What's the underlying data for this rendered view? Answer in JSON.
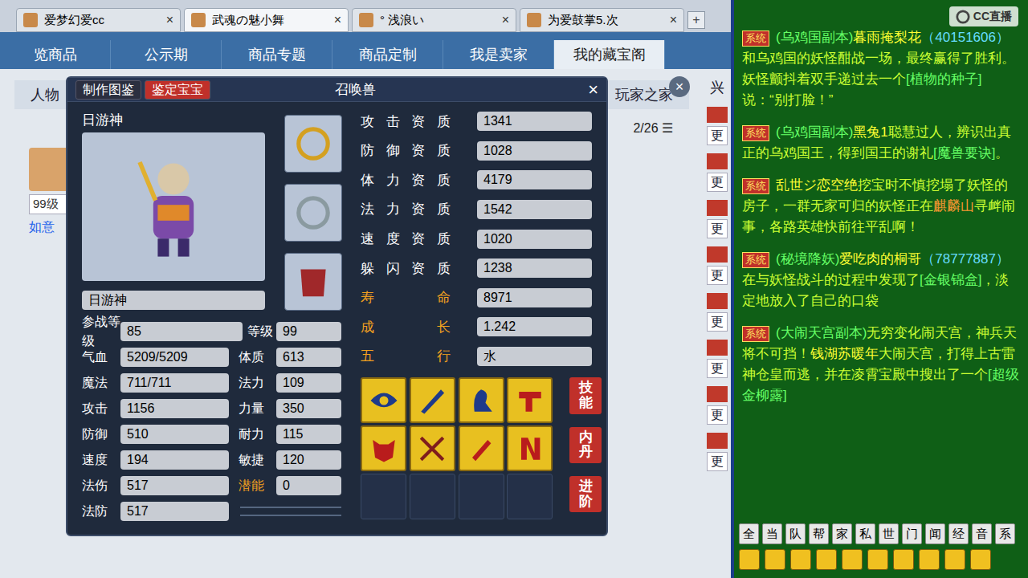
{
  "browser_tabs": [
    {
      "label": "爱梦幻爱cc",
      "selected": false,
      "close": "×"
    },
    {
      "label": "武魂の魅小舞",
      "selected": true,
      "close": "×"
    },
    {
      "label": "° 浅浪い",
      "selected": false,
      "close": "×"
    },
    {
      "label": "为爱鼓掌5.次",
      "selected": false,
      "close": "×"
    }
  ],
  "add_tab": "+",
  "nav": [
    {
      "label": "览商品",
      "selected": false
    },
    {
      "label": "公示期",
      "selected": false
    },
    {
      "label": "商品专题",
      "selected": false
    },
    {
      "label": "商品定制",
      "selected": false
    },
    {
      "label": "我是卖家",
      "selected": false
    },
    {
      "label": "我的藏宝阁",
      "selected": true
    }
  ],
  "page_close": "×",
  "background": {
    "tab_left": "人物",
    "tab_right": "玩家之家",
    "page_count": "2/26",
    "level": "99级",
    "link": "如意",
    "corner": "兴",
    "side_buttons": [
      "更",
      "更",
      "更",
      "更",
      "更",
      "更",
      "更",
      "更"
    ]
  },
  "dialog": {
    "buttons": [
      {
        "label": "制作图鉴",
        "selected": false
      },
      {
        "label": "鉴定宝宝",
        "selected": true
      }
    ],
    "title": "召唤兽",
    "close": "×",
    "pet_name": "日游神",
    "name_field": "日游神",
    "equipment_slots": 3,
    "battle_level": {
      "label": "参战等级",
      "value": "85"
    },
    "level": {
      "label": "等级",
      "value": "99"
    },
    "stats": [
      {
        "label": "气血",
        "value": "5209/5209",
        "label2": "体质",
        "value2": "613",
        "highlight2": false
      },
      {
        "label": "魔法",
        "value": "711/711",
        "label2": "法力",
        "value2": "109",
        "highlight2": false
      },
      {
        "label": "攻击",
        "value": "1156",
        "label2": "力量",
        "value2": "350",
        "highlight2": false
      },
      {
        "label": "防御",
        "value": "510",
        "label2": "耐力",
        "value2": "115",
        "highlight2": false
      },
      {
        "label": "速度",
        "value": "194",
        "label2": "敏捷",
        "value2": "120",
        "highlight2": false
      },
      {
        "label": "法伤",
        "value": "517",
        "label2": "潜能",
        "value2": "0",
        "highlight2": true
      },
      {
        "label": "法防",
        "value": "517",
        "label2": "",
        "value2": "",
        "highlight2": false
      }
    ],
    "aptitudes": [
      {
        "label": "攻击资质",
        "value": "1341",
        "highlight": false
      },
      {
        "label": "防御资质",
        "value": "1028",
        "highlight": false
      },
      {
        "label": "体力资质",
        "value": "4179",
        "highlight": false
      },
      {
        "label": "法力资质",
        "value": "1542",
        "highlight": false
      },
      {
        "label": "速度资质",
        "value": "1020",
        "highlight": false
      },
      {
        "label": "躲闪资质",
        "value": "1238",
        "highlight": false
      },
      {
        "label": "寿命",
        "value": "8971",
        "highlight": true
      },
      {
        "label": "成长",
        "value": "1.242",
        "highlight": true
      },
      {
        "label": "五行",
        "value": "水",
        "highlight": true
      }
    ],
    "skills": [
      {
        "filled": true
      },
      {
        "filled": true
      },
      {
        "filled": true
      },
      {
        "filled": true
      },
      {
        "filled": true
      },
      {
        "filled": true
      },
      {
        "filled": true
      },
      {
        "filled": true
      },
      {
        "filled": false
      },
      {
        "filled": false
      },
      {
        "filled": false
      },
      {
        "filled": false
      }
    ],
    "side_buttons": [
      "技能",
      "内丹",
      "进阶"
    ]
  },
  "chat": {
    "logo": "CC直播",
    "messages": [
      {
        "tag": "系统",
        "segments": [
          {
            "text": "(乌鸡国副本)",
            "color": "#66ff66"
          },
          {
            "text": "暮雨掩梨花",
            "color": "#ffff33"
          },
          {
            "text": "（40151606）",
            "color": "#66ddff"
          },
          {
            "text": "和乌鸡国的妖怪酣战一场，最终赢得了胜利。妖怪颤抖着双手递过去一个",
            "color": "#ccff33"
          },
          {
            "text": "[植物的种子]",
            "color": "#66ff66"
          },
          {
            "text": "说：“别打脸！”",
            "color": "#ccff33"
          }
        ]
      },
      {
        "tag": "系统",
        "segments": [
          {
            "text": "(乌鸡国副本)",
            "color": "#66ff66"
          },
          {
            "text": "黑兔1",
            "color": "#ffff33"
          },
          {
            "text": "聪慧过人，辨识出真正的乌鸡国王，得到国王的谢礼",
            "color": "#ccff33"
          },
          {
            "text": "[魔兽要诀]",
            "color": "#66ff66"
          },
          {
            "text": "。",
            "color": "#ccff33"
          }
        ]
      },
      {
        "tag": "系统",
        "segments": [
          {
            "text": "乱世ジ恋空绝",
            "color": "#ffff33"
          },
          {
            "text": "挖宝时不慎挖塌了妖怪的房子，一群无家可归的妖怪正在",
            "color": "#ccff33"
          },
          {
            "text": "麒麟山",
            "color": "#ff9933"
          },
          {
            "text": "寻衅闹事，各路英雄快前往平乱啊！",
            "color": "#ccff33"
          }
        ]
      },
      {
        "tag": "系统",
        "segments": [
          {
            "text": "(秘境降妖)",
            "color": "#66ff66"
          },
          {
            "text": "爱吃肉的桐哥",
            "color": "#ffff33"
          },
          {
            "text": "（78777887）",
            "color": "#66ddff"
          },
          {
            "text": "在与妖怪战斗的过程中发现了",
            "color": "#ccff33"
          },
          {
            "text": "[金银锦盒]",
            "color": "#66ff66"
          },
          {
            "text": "，淡定地放入了自己的口袋",
            "color": "#ccff33"
          }
        ]
      },
      {
        "tag": "系统",
        "segments": [
          {
            "text": "(大闹天宫副本)",
            "color": "#66ff66"
          },
          {
            "text": "无穷变化闹天宫，神兵天将不可挡！",
            "color": "#ccff33"
          },
          {
            "text": "钱湖苏暖年",
            "color": "#ffff33"
          },
          {
            "text": "大闹天宫，打得上古雷神仓皇而逃，并在凌霄宝殿中搜出了一个",
            "color": "#ccff33"
          },
          {
            "text": "[超级金柳露]",
            "color": "#66ff66"
          }
        ]
      }
    ],
    "channels": [
      "全",
      "当",
      "队",
      "帮",
      "家",
      "私",
      "世",
      "门",
      "闻",
      "经",
      "音",
      "系"
    ],
    "tool_count": 10
  }
}
